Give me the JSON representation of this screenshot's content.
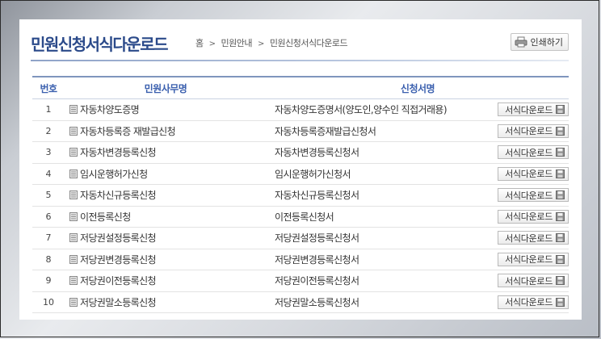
{
  "header": {
    "title": "민원신청서식다운로드",
    "breadcrumb": [
      "홈",
      "민원안내",
      "민원신청서식다운로드"
    ],
    "print_label": "인쇄하기"
  },
  "table": {
    "columns": [
      "번호",
      "민원사무명",
      "신청서명"
    ],
    "download_label": "서식다운로드",
    "rows": [
      {
        "num": "1",
        "task": "자동차양도증명",
        "form": "자동차양도증명서(양도인,양수인 직접거래용)"
      },
      {
        "num": "2",
        "task": "자동차등록증 재발급신청",
        "form": "자동차등록증재발급신청서"
      },
      {
        "num": "3",
        "task": "자동차변경등록신청",
        "form": "자동차변경등록신청서"
      },
      {
        "num": "4",
        "task": "임시운행허가신청",
        "form": "임시운행허가신청서"
      },
      {
        "num": "5",
        "task": "자동차신규등록신청",
        "form": "자동차신규등록신청서"
      },
      {
        "num": "6",
        "task": "이전등록신청",
        "form": "이전등록신청서"
      },
      {
        "num": "7",
        "task": "저당권설정등록신청",
        "form": "저당권설정등록신청서"
      },
      {
        "num": "8",
        "task": "저당권변경등록신청",
        "form": "저당권변경등록신청서"
      },
      {
        "num": "9",
        "task": "저당권이전등록신청",
        "form": "저당권이전등록신청서"
      },
      {
        "num": "10",
        "task": "저당권말소등록신청",
        "form": "저당권말소등록신청서"
      }
    ]
  }
}
